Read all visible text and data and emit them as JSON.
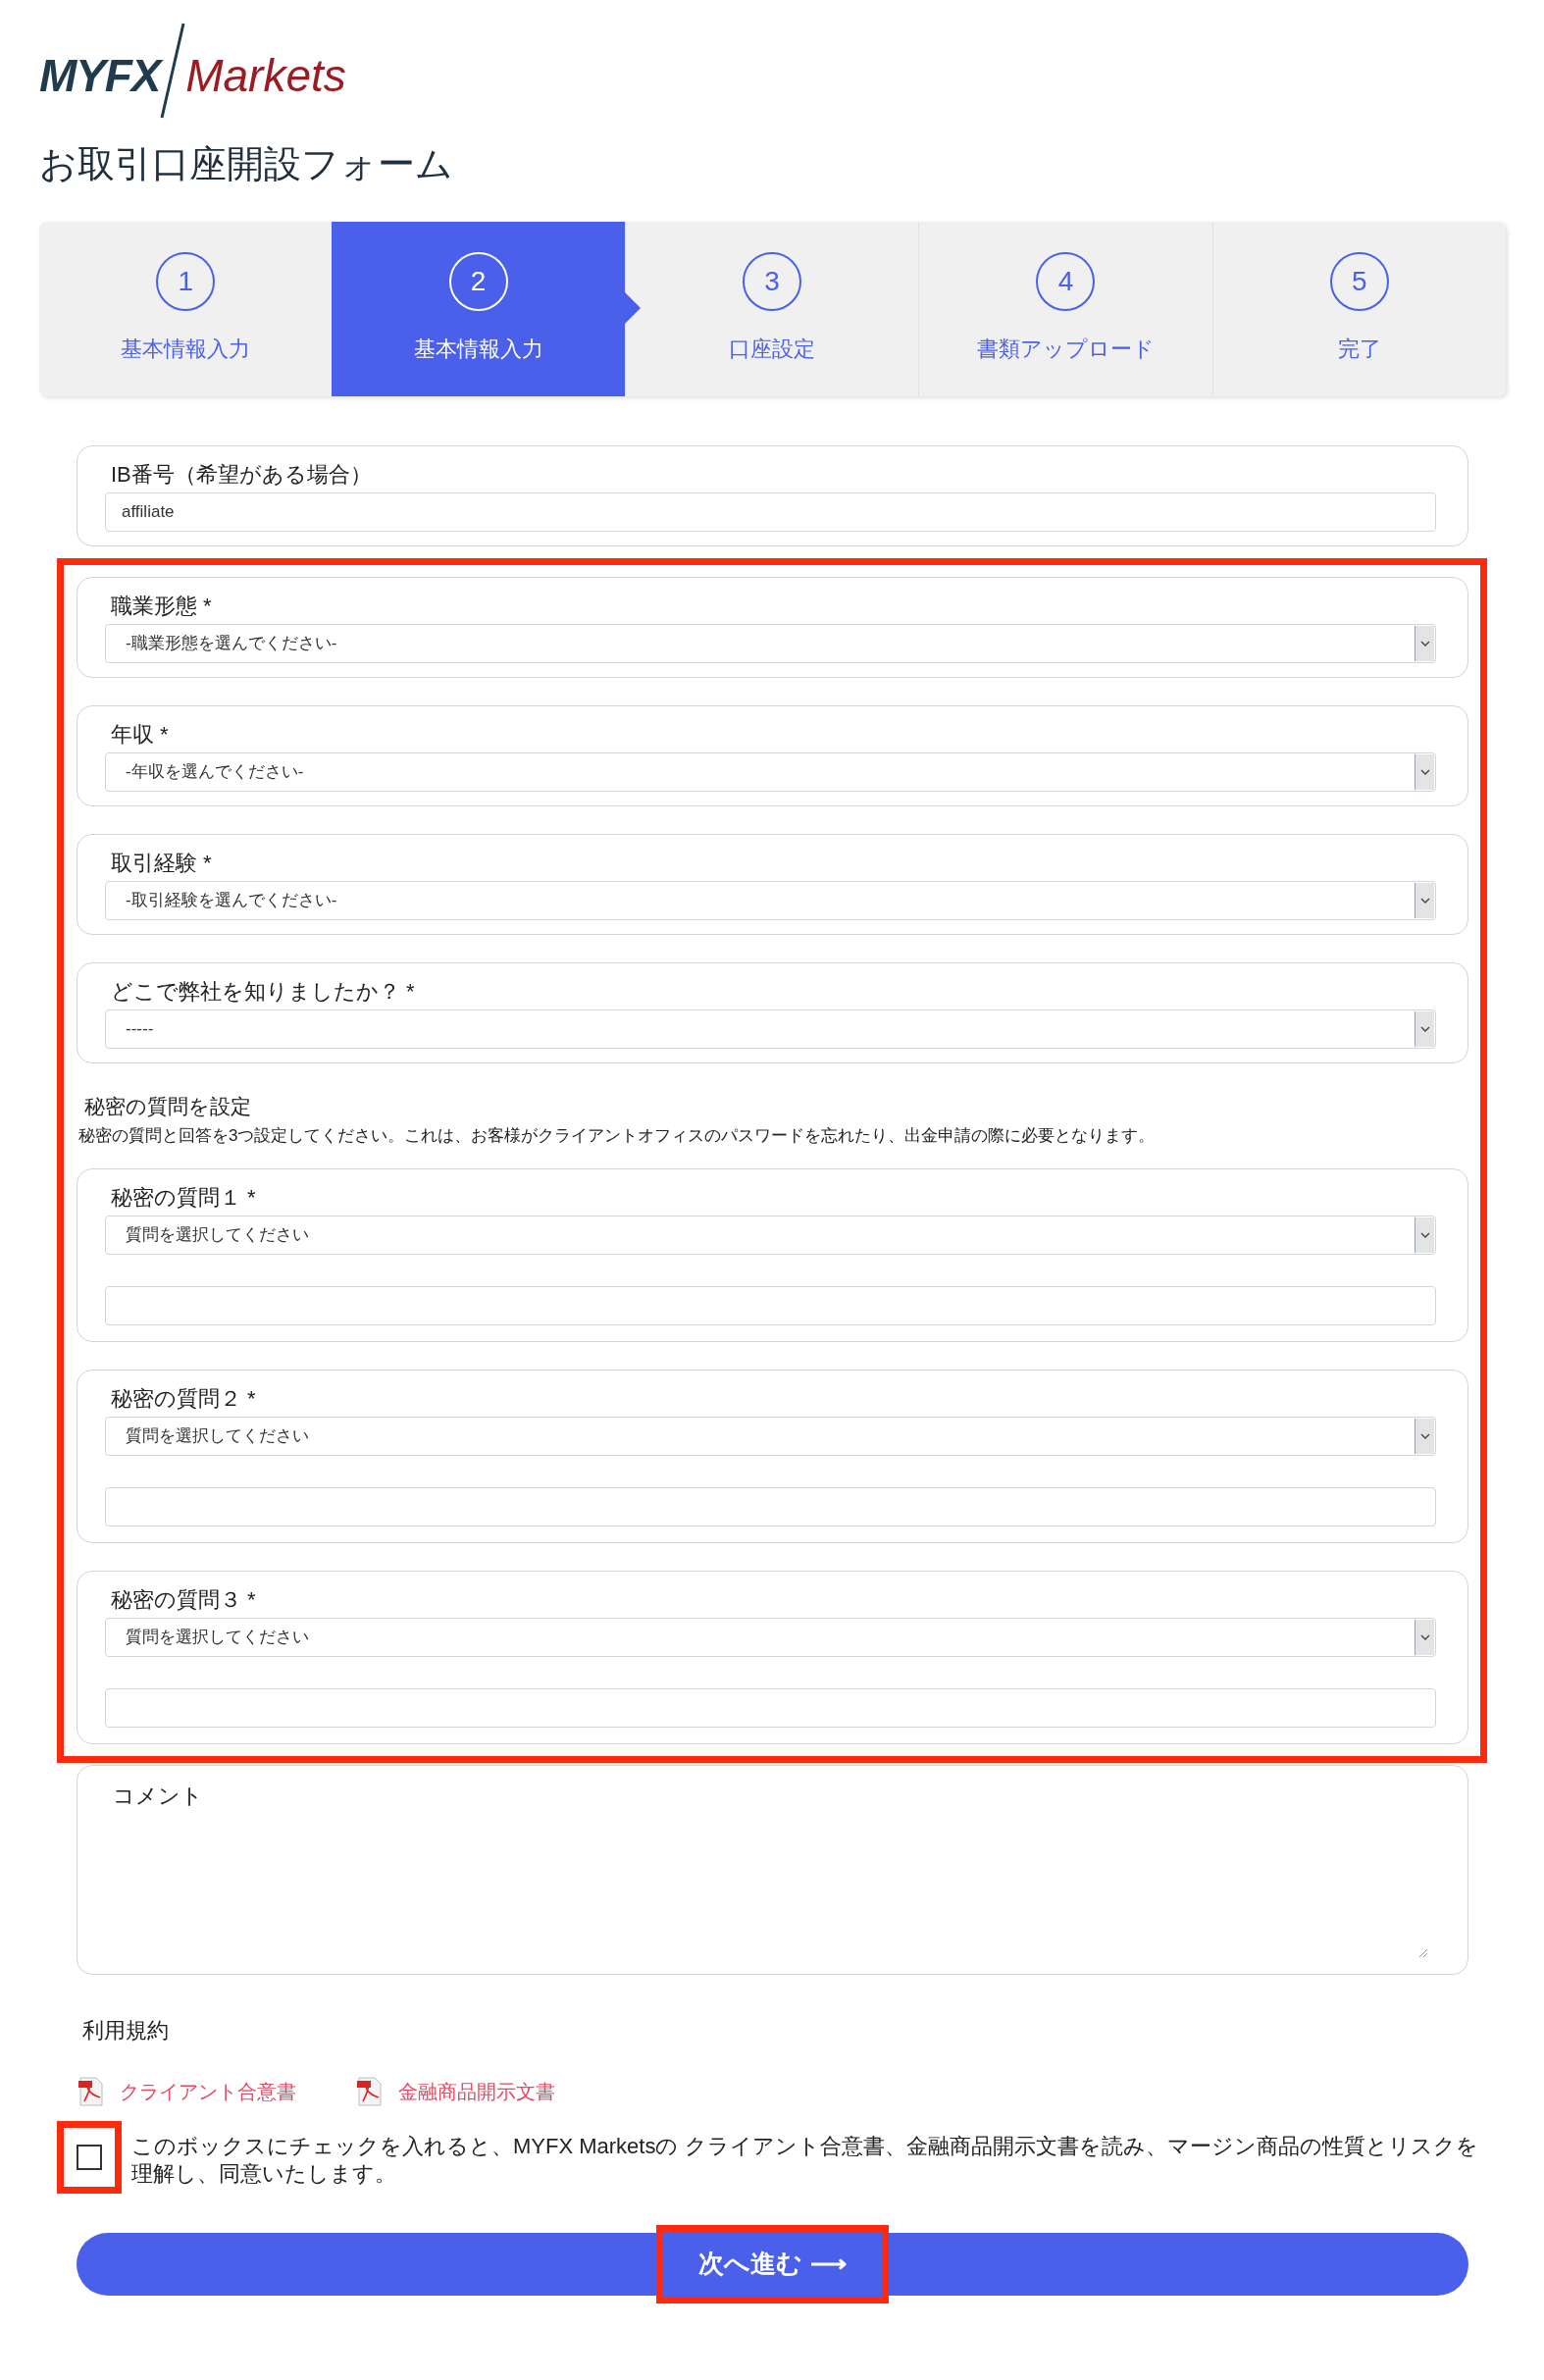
{
  "logo": {
    "brand": "MYFX",
    "suffix": "Markets"
  },
  "title": "お取引口座開設フォーム",
  "steps": [
    {
      "number": "1",
      "label": "基本情報入力",
      "selected": false
    },
    {
      "number": "2",
      "label": "基本情報入力",
      "selected": true
    },
    {
      "number": "3",
      "label": "口座設定",
      "selected": false
    },
    {
      "number": "4",
      "label": "書類アップロード",
      "selected": false
    },
    {
      "number": "5",
      "label": "完了",
      "selected": false
    }
  ],
  "ib_field": {
    "label": "IB番号（希望がある場合）",
    "value": "affiliate"
  },
  "selects": [
    {
      "label": "職業形態 *",
      "value": "-職業形態を選んでください-"
    },
    {
      "label": "年収 *",
      "value": "-年収を選んでください-"
    },
    {
      "label": "取引経験 *",
      "value": "-取引経験を選んでください-"
    },
    {
      "label": "どこで弊社を知りましたか？ *",
      "value": "-----"
    }
  ],
  "secret": {
    "heading": "秘密の質問を設定",
    "description": "秘密の質問と回答を3つ設定してください。これは、お客様がクライアントオフィスのパスワードを忘れたり、出金申請の際に必要となります。",
    "questions": [
      {
        "label": "秘密の質問１ *",
        "value": "質問を選択してください"
      },
      {
        "label": "秘密の質問２ *",
        "value": "質問を選択してください"
      },
      {
        "label": "秘密の質問３ *",
        "value": "質問を選択してください"
      }
    ]
  },
  "comment": {
    "label": "コメント"
  },
  "terms": {
    "heading": "利用規約",
    "links": [
      "クライアント合意書",
      "金融商品開示文書"
    ],
    "agree": {
      "checked": false,
      "text": "このボックスにチェックを入れると、MYFX Marketsの クライアント合意書、金融商品開示文書を読み、マージン商品の性質とリスクを理解し、同意いたします。"
    }
  },
  "next_button": {
    "label": "次へ進む ⟶"
  }
}
